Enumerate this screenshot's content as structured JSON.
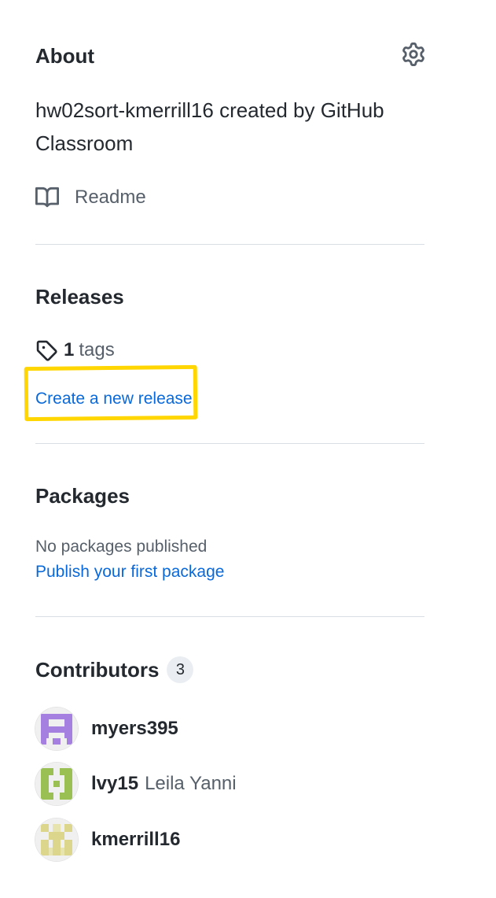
{
  "about": {
    "heading": "About",
    "description": "hw02sort-kmerrill16 created by GitHub Classroom",
    "readme_label": "Readme",
    "settings_icon": "gear-icon"
  },
  "releases": {
    "heading": "Releases",
    "tag_count": "1",
    "tag_label": "tags",
    "create_link": "Create a new release",
    "highlight_color": "#ffd600"
  },
  "packages": {
    "heading": "Packages",
    "empty_text": "No packages published",
    "publish_link": "Publish your first package"
  },
  "contributors": {
    "heading": "Contributors",
    "count": "3",
    "items": [
      {
        "login": "myers395",
        "name": ""
      },
      {
        "login": "lvy15",
        "name": "Leila Yanni"
      },
      {
        "login": "kmerrill16",
        "name": ""
      }
    ]
  },
  "colors": {
    "text": "#24292f",
    "muted": "#57606a",
    "link": "#0969da",
    "divider": "#d8dee4"
  }
}
